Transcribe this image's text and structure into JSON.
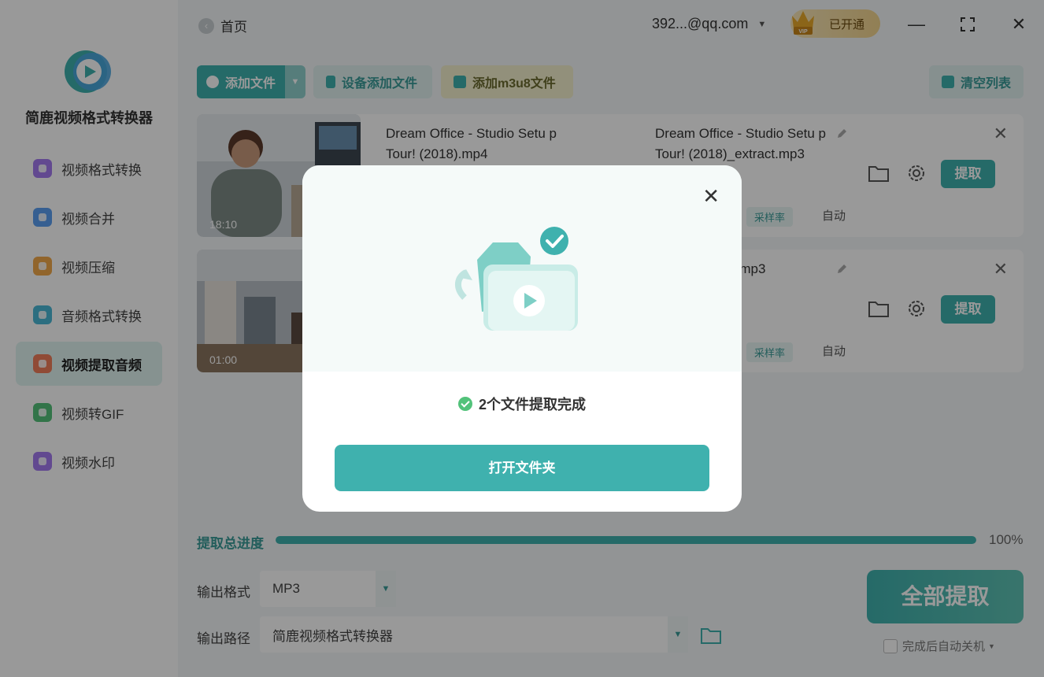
{
  "app": {
    "name": "简鹿视频格式转换器"
  },
  "sidebar": {
    "items": [
      {
        "label": "视频格式转换",
        "color": "#a37af0"
      },
      {
        "label": "视频合并",
        "color": "#5b9ef2"
      },
      {
        "label": "视频压缩",
        "color": "#f2a94a"
      },
      {
        "label": "音频格式转换",
        "color": "#4ab7d6"
      },
      {
        "label": "视频提取音频",
        "color": "#f07d5b"
      },
      {
        "label": "视频转GIF",
        "color": "#54c27a"
      },
      {
        "label": "视频水印",
        "color": "#a37af0"
      }
    ],
    "active_index": 4
  },
  "topbar": {
    "home_label": "首页",
    "account": "392...@qq.com",
    "vip_label": "已开通",
    "vip_badge": "VIP"
  },
  "toolbar": {
    "add_file": "添加文件",
    "device_add": "设备添加文件",
    "add_m3u8": "添加m3u8文件",
    "clear_list": "清空列表"
  },
  "files": [
    {
      "name": "Dream Office - Studio Setu p Tour! (2018).mp4",
      "output": "Dream Office - Studio Setu p Tour! (2018)_extract.mp3",
      "duration": "18:10",
      "meta_tag": "采样率",
      "meta_value": "自动",
      "extract_label": "提取"
    },
    {
      "name": "",
      "output": "Office walkthr mp3",
      "duration": "01:00",
      "meta_tag": "采样率",
      "meta_value": "自动",
      "extract_label": "提取"
    }
  ],
  "progress": {
    "label": "提取总进度",
    "value": 1.0,
    "text": "100%"
  },
  "output": {
    "format_label": "输出格式",
    "format_value": "MP3",
    "path_label": "输出路径",
    "path_value": "简鹿视频格式转换器"
  },
  "extract_all": "全部提取",
  "auto_shutdown": "完成后自动关机",
  "modal": {
    "status": "2个文件提取完成",
    "button": "打开文件夹"
  },
  "colors": {
    "accent": "#3fb1ae",
    "success": "#52c27a"
  }
}
